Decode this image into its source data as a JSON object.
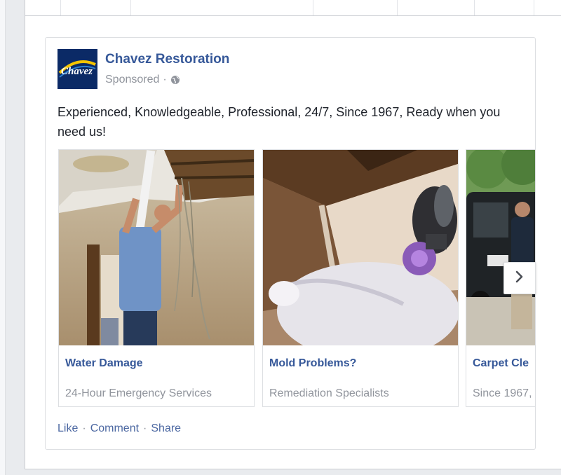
{
  "ad": {
    "page_name": "Chavez Restoration",
    "sponsored": "Sponsored",
    "separator": "·",
    "logo_text": "Chavez",
    "body_text": "Experienced, Knowledgeable, Professional, 24/7, Since 1967, Ready when you need us!"
  },
  "carousel": {
    "cards": [
      {
        "title": "Water Damage",
        "subtitle": "24-Hour Emergency Services"
      },
      {
        "title": "Mold Problems?",
        "subtitle": "Remediation Specialists"
      },
      {
        "title": "Carpet Cle",
        "subtitle": "Since 1967,"
      }
    ],
    "next_icon": "chevron-right-icon"
  },
  "actions": {
    "like": "Like",
    "comment": "Comment",
    "share": "Share",
    "separator": "·"
  },
  "colors": {
    "link": "#365899",
    "muted": "#90949c",
    "text": "#1d2129",
    "border": "#dddfe2",
    "logo_bg": "#0b2a66",
    "logo_accent": "#f5c400"
  }
}
